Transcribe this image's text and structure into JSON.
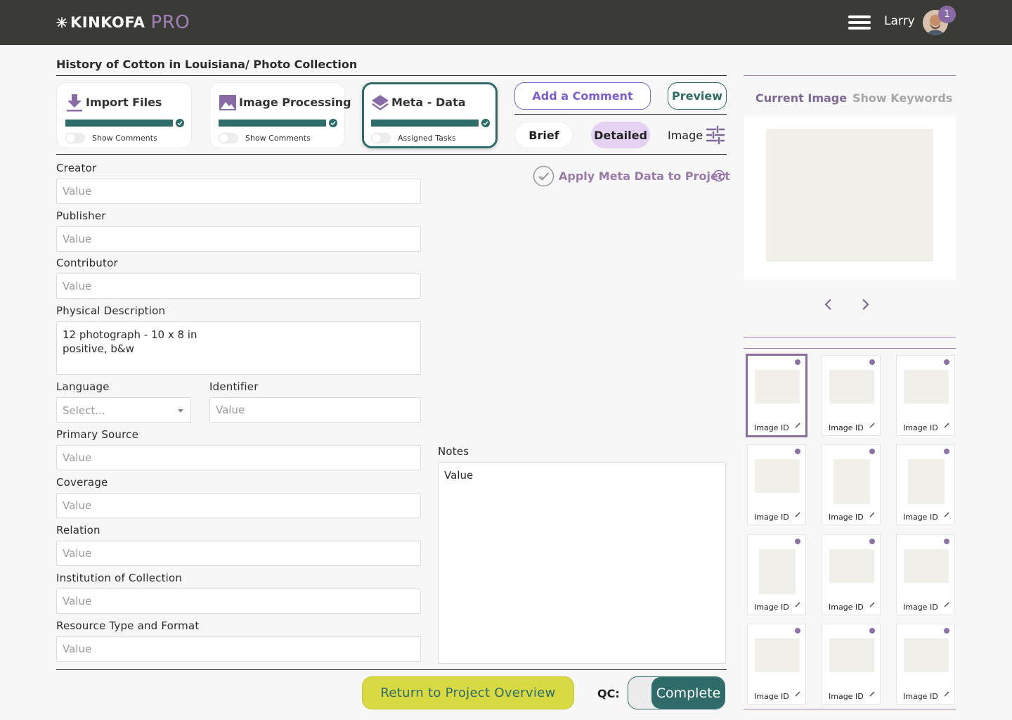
{
  "header": {
    "brand": "KINKOFA",
    "brand_suffix": "PRO",
    "user_name": "Larry",
    "notification_count": "1",
    "brand_color": "#3a3b37",
    "accent_color": "#a27fb7"
  },
  "page": {
    "title": "History of Cotton in Louisiana/ Photo Collection"
  },
  "steps": [
    {
      "title": "Import Files",
      "toggle_label": "Show Comments",
      "progress": 1.0,
      "icon": "download-icon"
    },
    {
      "title": "Image Processing",
      "toggle_label": "Show Comments",
      "progress": 1.0,
      "icon": "image-icon"
    },
    {
      "title": "Meta - Data",
      "toggle_label": "Assigned Tasks",
      "progress": 1.0,
      "icon": "layers-icon",
      "active": true
    }
  ],
  "actions": {
    "add_comment": "Add a Comment",
    "preview": "Preview",
    "view_modes": [
      "Brief",
      "Detailed",
      "Image"
    ],
    "selected_view": "Detailed",
    "apply_meta": "Apply Meta Data to Project"
  },
  "form": {
    "creator": {
      "label": "Creator",
      "placeholder": "Value"
    },
    "publisher": {
      "label": "Publisher",
      "placeholder": "Value"
    },
    "contributor": {
      "label": "Contributor",
      "placeholder": "Value"
    },
    "physical_description": {
      "label": "Physical Description",
      "value": "12 photograph - 10 x 8 in\npositive, b&w"
    },
    "language": {
      "label": "Language",
      "placeholder": "Select..."
    },
    "identifier": {
      "label": "Identifier",
      "placeholder": "Value"
    },
    "primary_source": {
      "label": "Primary Source",
      "placeholder": "Value"
    },
    "coverage": {
      "label": "Coverage",
      "placeholder": "Value"
    },
    "relation": {
      "label": "Relation",
      "placeholder": "Value"
    },
    "institution": {
      "label": "Institution of Collection",
      "placeholder": "Value"
    },
    "resource_type": {
      "label": "Resource Type and Format",
      "placeholder": "Value"
    },
    "notes": {
      "label": "Notes",
      "value": "Value"
    }
  },
  "footer": {
    "return_label": "Return to Project Overview",
    "qc_label": "QC:",
    "qc_status": "Complete",
    "primary_color": "#2f6b69",
    "return_color": "#d9d944"
  },
  "right_panel": {
    "tabs": [
      "Current Image",
      "Show Keywords"
    ],
    "active_tab": "Current Image",
    "thumbnails": [
      {
        "label": "Image ID",
        "selected": true
      },
      {
        "label": "Image ID"
      },
      {
        "label": "Image ID"
      },
      {
        "label": "Image ID"
      },
      {
        "label": "Image ID"
      },
      {
        "label": "Image ID"
      },
      {
        "label": "Image ID"
      },
      {
        "label": "Image ID"
      },
      {
        "label": "Image ID"
      },
      {
        "label": "Image ID"
      },
      {
        "label": "Image ID"
      },
      {
        "label": "Image ID"
      }
    ]
  }
}
